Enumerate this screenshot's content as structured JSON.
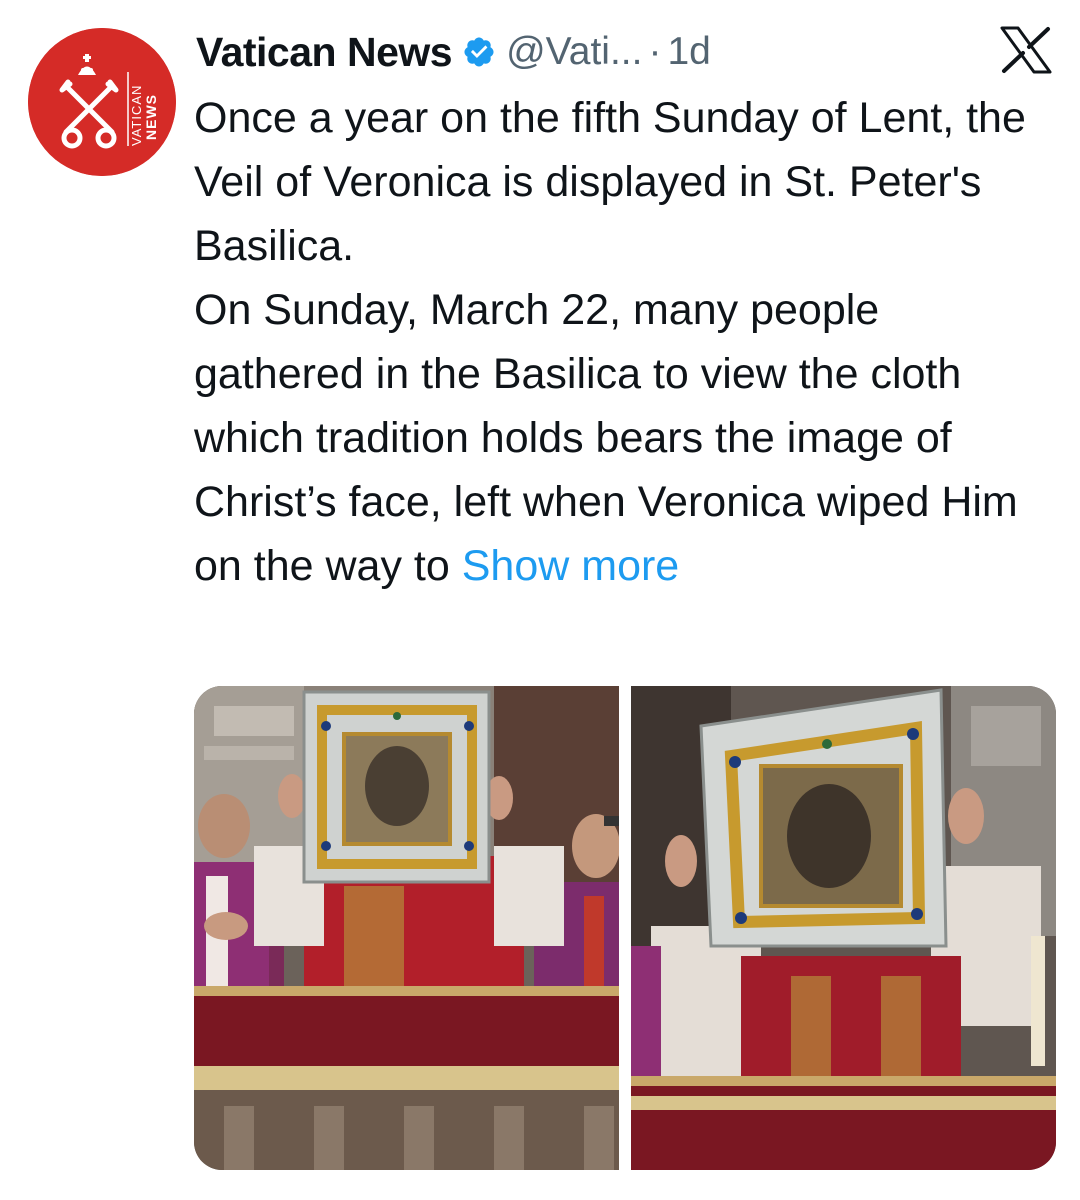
{
  "account": {
    "display_name": "Vatican News",
    "handle": "@Vati...",
    "separator": "·",
    "time": "1d",
    "verified": true,
    "avatar": {
      "brand_color": "#d52b27",
      "lines": [
        "VATICAN",
        "NEWS"
      ],
      "icon": "papal-keys-icon"
    }
  },
  "platform_logo": "x-logo-icon",
  "tweet": {
    "paragraph_1": "Once a year on the fifth Sunday of Lent, the Veil of Veronica is displayed in St. Peter's Basilica.",
    "paragraph_2": "On Sunday, March 22, many people gathered in the Basilica to view the cloth which tradition holds bears the image of Christ’s face, left when Veronica wiped Him on the way to",
    "show_more": "Show more"
  },
  "media": {
    "count": 2,
    "photos": [
      "clergy-holding-veil-reliquary-photo",
      "veil-reliquary-closeup-photo"
    ]
  },
  "colors": {
    "link": "#1d9bf0",
    "secondary_text": "#536471",
    "verified_badge": "#1d9bf0"
  }
}
